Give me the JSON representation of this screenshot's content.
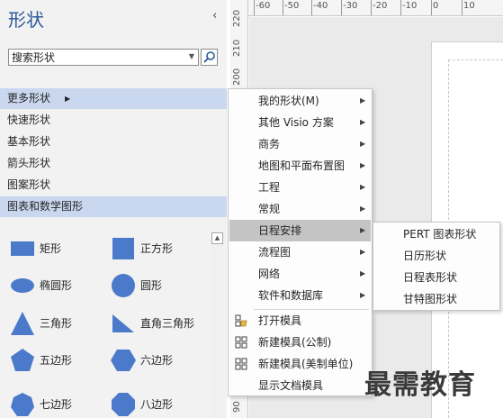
{
  "pane": {
    "title": "形状",
    "collapse_glyph": "‹",
    "search_placeholder": "搜索形状",
    "search_value": "搜索形状"
  },
  "categories": [
    {
      "label": "更多形状",
      "has_arrow": true
    },
    {
      "label": "快速形状"
    },
    {
      "label": "基本形状"
    },
    {
      "label": "箭头形状"
    },
    {
      "label": "图案形状"
    },
    {
      "label": "图表和数学图形",
      "selected": true
    }
  ],
  "shapes": [
    {
      "label": "矩形",
      "icon": "rectangle-icon"
    },
    {
      "label": "正方形",
      "icon": "square-icon"
    },
    {
      "label": "椭圆形",
      "icon": "ellipse-icon"
    },
    {
      "label": "圆形",
      "icon": "circle-icon"
    },
    {
      "label": "三角形",
      "icon": "triangle-icon"
    },
    {
      "label": "直角三角形",
      "icon": "right-triangle-icon"
    },
    {
      "label": "五边形",
      "icon": "pentagon-icon"
    },
    {
      "label": "六边形",
      "icon": "hexagon-icon"
    },
    {
      "label": "七边形",
      "icon": "heptagon-icon"
    },
    {
      "label": "八边形",
      "icon": "octagon-icon"
    }
  ],
  "menu": {
    "items": [
      {
        "label": "我的形状(M)",
        "arrow": true
      },
      {
        "label": "其他 Visio 方案",
        "arrow": true
      },
      {
        "label": "商务",
        "arrow": true
      },
      {
        "label": "地图和平面布置图",
        "arrow": true
      },
      {
        "label": "工程",
        "arrow": true
      },
      {
        "label": "常规",
        "arrow": true
      },
      {
        "label": "日程安排",
        "arrow": true,
        "highlighted": true
      },
      {
        "label": "流程图",
        "arrow": true
      },
      {
        "label": "网络",
        "arrow": true
      },
      {
        "label": "软件和数据库",
        "arrow": true
      },
      {
        "label": "打开模具",
        "icon": "open-stencil-icon"
      },
      {
        "label": "新建模具(公制)",
        "icon": "new-stencil-icon"
      },
      {
        "label": "新建模具(美制单位)",
        "icon": "new-stencil-icon"
      },
      {
        "label": "显示文档模具"
      }
    ]
  },
  "submenu": {
    "items": [
      "PERT 图表形状",
      "日历形状",
      "日程表形状",
      "甘特图形状"
    ]
  },
  "ruler": {
    "horizontal": [
      "-60",
      "-50",
      "-40",
      "-30",
      "-20",
      "-10",
      "0",
      "10"
    ],
    "vertical": [
      "220",
      "210",
      "200",
      "90"
    ]
  },
  "watermark": "最需教育",
  "colors": {
    "accent": "#2b579a",
    "shape_fill": "#4a7ac9",
    "selected_bg": "#c9d7ef",
    "menu_highlight": "#c4c4c4"
  }
}
